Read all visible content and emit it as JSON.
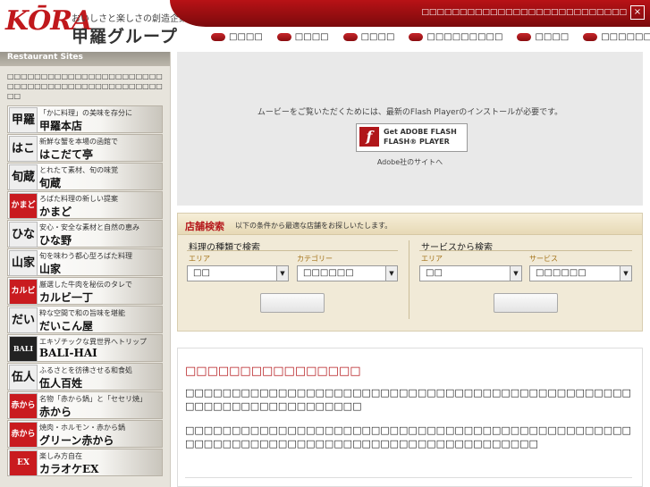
{
  "header": {
    "logo_mark": "KŌRA",
    "tagline": "おいしさと楽しさの創造企業",
    "company": "甲羅グループ",
    "top_link": "□□□□□□□□□□□□□□□□□□□□□□□□□□□",
    "close_symbol": "×",
    "colors": {
      "brand_red": "#c0181c"
    }
  },
  "nav": [
    {
      "label": "□□□□"
    },
    {
      "label": "□□□□"
    },
    {
      "label": "□□□□"
    },
    {
      "label": "□□□□□□□□□"
    },
    {
      "label": "□□□□"
    },
    {
      "label": "□□□□□□"
    }
  ],
  "sidebar": {
    "heading": "Restaurant Sites",
    "description": "□□□□□□□□□□□□□□□□□□□□□□□□□□□□□□□□□□□□□□□□□□□□□□□□",
    "sites": [
      {
        "logo": "甲羅",
        "sub": "「かに料理」の美味を存分に",
        "name": "甲羅本店"
      },
      {
        "logo": "はこだて",
        "sub": "新鮮な蟹を本場の函館で",
        "name": "はこだて亭"
      },
      {
        "logo": "旬蔵",
        "sub": "とれたて素材、旬の味覚",
        "name": "旬蔵"
      },
      {
        "logo": "かまど",
        "sub": "ろばた料理の新しい提案",
        "name": "かまど"
      },
      {
        "logo": "ひな野",
        "sub": "安心・安全な素材と自然の恵み",
        "name": "ひな野"
      },
      {
        "logo": "山家",
        "sub": "旬を味わう都心型ろばた料理",
        "name": "山家"
      },
      {
        "logo": "カルビ",
        "sub": "厳選した牛肉を秘伝のタレで",
        "name": "カルビ一丁"
      },
      {
        "logo": "だいこん",
        "sub": "粋な空間で和の旨味を堪能",
        "name": "だいこん屋"
      },
      {
        "logo": "BALI",
        "sub": "エキゾチックな異世界へトリップ",
        "name": "BALI-HAI"
      },
      {
        "logo": "伍人",
        "sub": "ふるさとを彷彿させる和食処",
        "name": "伍人百姓"
      },
      {
        "logo": "赤から",
        "sub": "名物「赤から鍋」と「セセリ焼」",
        "name": "赤から"
      },
      {
        "logo": "赤から",
        "sub": "焼肉・ホルモン・赤から鍋",
        "name": "グリーン赤から"
      },
      {
        "logo": "EX",
        "sub": "楽しみ方自在",
        "name": "カラオケEX"
      }
    ]
  },
  "flash": {
    "message": "ムービーをご覧いただくためには、最新のFlash Playerのインストールが必要です。",
    "badge_line1": "Get ADOBE FLASH",
    "badge_line2": "FLASH® PLAYER",
    "badge_icon": "f",
    "link": "Adobe社のサイトへ"
  },
  "search": {
    "title": "店舗検索",
    "description": "以下の条件から最適な店舗をお探しいたします。",
    "left": {
      "title": "料理の種類で検索",
      "label1": "エリア",
      "value1": "□□",
      "label2": "カテゴリー",
      "value2": "□□□□□□",
      "button": ""
    },
    "right": {
      "title": "サービスから検索",
      "label1": "エリア",
      "value1": "□□",
      "label2": "サービス",
      "value2": "□□□□□□",
      "button": ""
    }
  },
  "news": {
    "title": "□□□□□□□□□□□□□□□□",
    "p1": "□□□□□□□□□□□□□□□□□□□□□□□□□□□□□□□□□□□□□□□□□□□□□□□□□□□□□□□□□□□□□□□□□□□",
    "p2": "□□□□□□□□□□□□□□□□□□□□□□□□□□□□□□□□□□□□□□□□□□□□□□□□□□□□□□□□□□□□□□□□□□□□□□□□□□□□□□□□□□□□□□"
  }
}
